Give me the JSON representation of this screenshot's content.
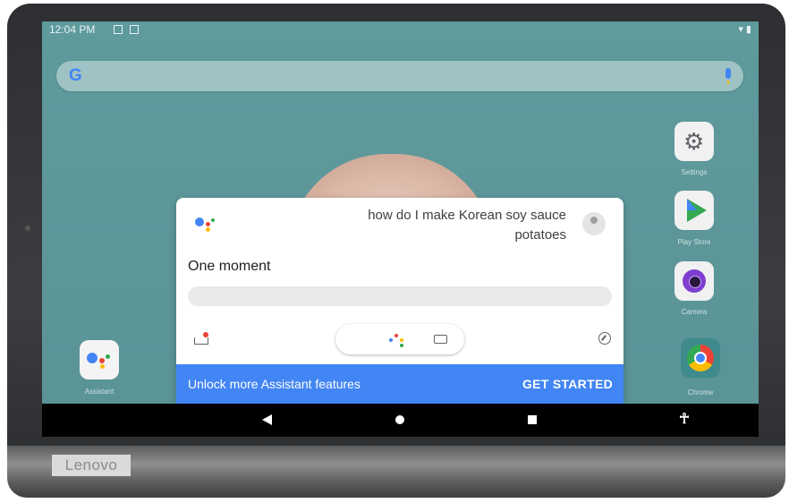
{
  "status_bar": {
    "time": "12:04 PM"
  },
  "search": {
    "logo_text": "G"
  },
  "apps": [
    {
      "label": "Settings",
      "icon": "settings-icon"
    },
    {
      "label": "Play Store",
      "icon": "play-store-icon"
    },
    {
      "label": "Camera",
      "icon": "camera-icon"
    },
    {
      "label": "Chrome",
      "icon": "chrome-icon"
    },
    {
      "label": "Assistant",
      "icon": "assistant-icon"
    }
  ],
  "assistant": {
    "query": "how do I make Korean soy sauce potatoes",
    "status": "One moment",
    "promo_text": "Unlock more Assistant features",
    "promo_cta": "GET STARTED"
  },
  "device": {
    "brand": "Lenovo"
  },
  "colors": {
    "google_blue": "#4285f4",
    "google_red": "#ea4335",
    "google_yellow": "#fbbc05",
    "google_green": "#34a853"
  }
}
